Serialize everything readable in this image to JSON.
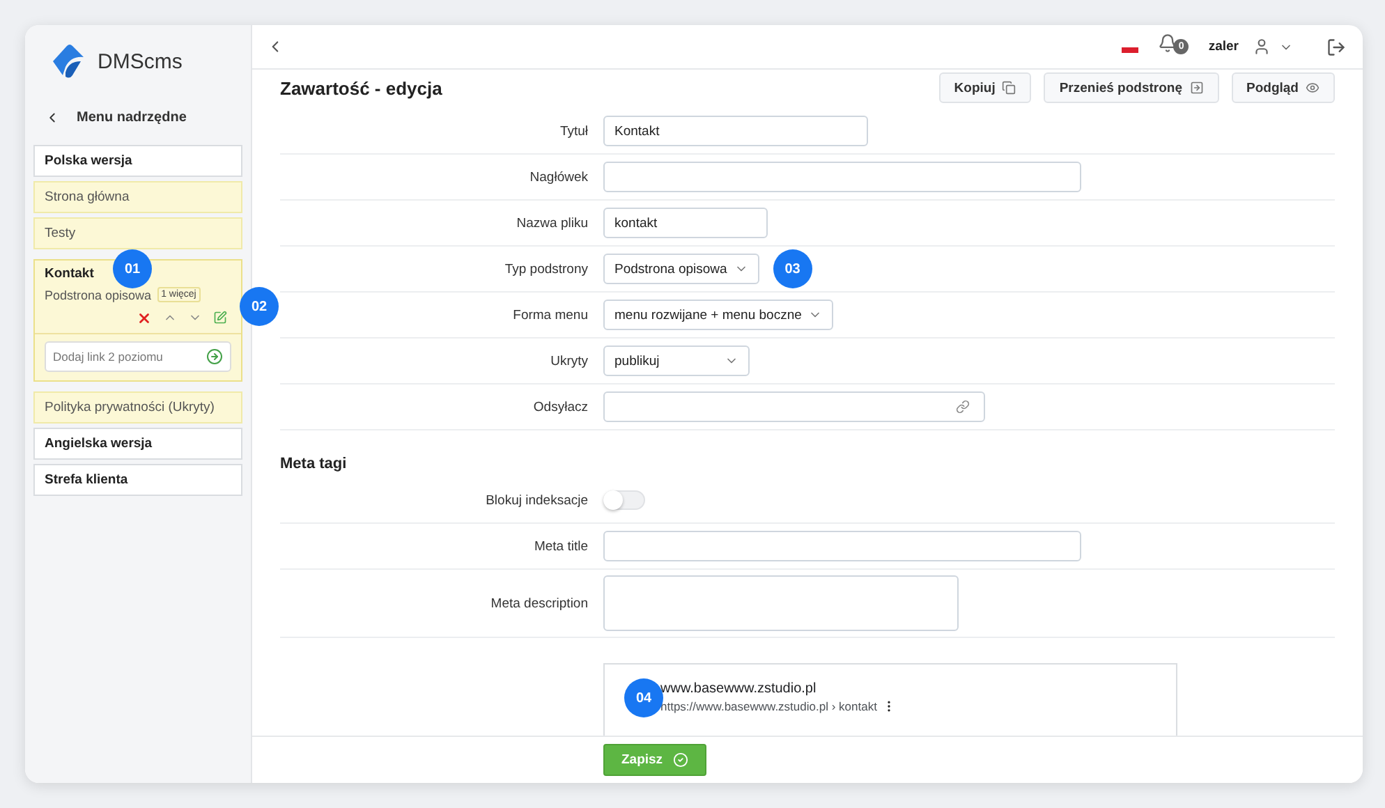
{
  "sidebar": {
    "logo": "DMScms",
    "back": "Menu nadrzędne",
    "items": [
      {
        "label": "Polska wersja",
        "kind": "root",
        "expanded": false
      },
      {
        "label": "Strona główna",
        "kind": "page",
        "expanded": false
      },
      {
        "label": "Testy",
        "kind": "page",
        "expanded": false
      },
      {
        "label": "Kontakt",
        "kind": "page",
        "expanded": true,
        "subtitle": "Podstrona opisowa",
        "more": "1 więcej",
        "callout": "01",
        "actions_callout": "02",
        "add_placeholder": "Dodaj link 2 poziomu"
      },
      {
        "label": "Polityka prywatności (Ukryty)",
        "kind": "page",
        "expanded": false
      },
      {
        "label": "Angielska wersja",
        "kind": "root",
        "expanded": false
      },
      {
        "label": "Strefa klienta",
        "kind": "root",
        "expanded": false
      }
    ]
  },
  "topbar": {
    "notifications": "0",
    "user": "zaler"
  },
  "content": {
    "title": "Zawartość - edycja",
    "actions": [
      "Kopiuj",
      "Przenieś podstronę",
      "Podgląd"
    ],
    "fields": [
      {
        "label": "Tytuł",
        "kind": "text",
        "value": "Kontakt"
      },
      {
        "label": "Nagłówek",
        "kind": "text"
      },
      {
        "label": "Nazwa pliku",
        "kind": "text",
        "value": "kontakt"
      },
      {
        "label": "Typ podstrony",
        "kind": "select",
        "value": "Podstrona opisowa",
        "callout": "03"
      },
      {
        "label": "Forma menu",
        "kind": "select",
        "value": "menu rozwijane + menu boczne"
      },
      {
        "label": "Ukryty",
        "kind": "select",
        "value": "publikuj"
      },
      {
        "label": "Odsyłacz",
        "kind": "link"
      }
    ],
    "meta": {
      "title": "Meta tagi",
      "fields": [
        {
          "label": "Blokuj indeksacje",
          "kind": "toggle",
          "on": false
        },
        {
          "label": "Meta title",
          "kind": "text"
        },
        {
          "label": "Meta description",
          "kind": "textarea"
        }
      ]
    },
    "preview": {
      "site": "www.basewww.zstudio.pl",
      "url": "https://www.basewww.zstudio.pl › kontakt",
      "callout": "04"
    }
  },
  "save": "Zapisz"
}
